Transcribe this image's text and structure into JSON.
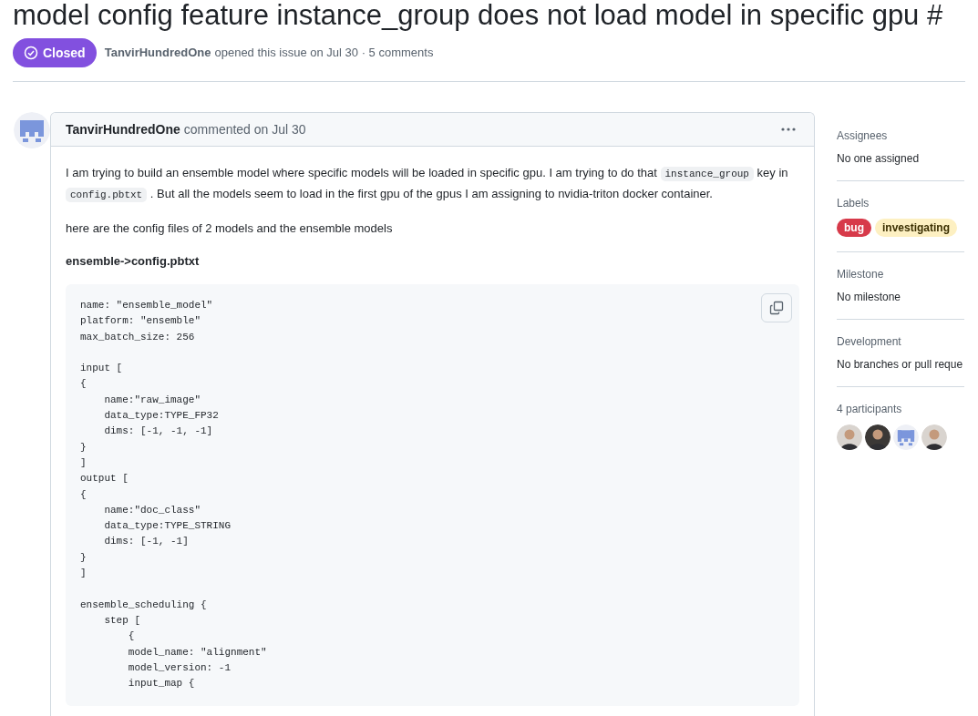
{
  "issue": {
    "title": "model config feature instance_group does not load model in specific gpu #",
    "status": "Closed",
    "author": "TanvirHundredOne",
    "meta": "opened this issue on Jul 30 · 5 comments"
  },
  "comment": {
    "author": "TanvirHundredOne",
    "meta": "commented on Jul 30",
    "body": [
      {
        "kind": "paragraph",
        "segments": [
          {
            "kind": "text",
            "text": "I am trying to build an ensemble model where specific models will be loaded in specific gpu. I am trying to do that "
          },
          {
            "kind": "code",
            "text": "instance_group"
          },
          {
            "kind": "text",
            "text": " key in "
          },
          {
            "kind": "code",
            "text": "config.pbtxt"
          },
          {
            "kind": "text",
            "text": " . But all the models seem to load in the first gpu of the gpus I am assigning to nvidia-triton docker container."
          }
        ]
      },
      {
        "kind": "paragraph",
        "segments": [
          {
            "kind": "text",
            "text": "here are the config files of 2 models and the ensemble models"
          }
        ]
      },
      {
        "kind": "heading",
        "text": "ensemble->config.pbtxt"
      },
      {
        "kind": "code",
        "text": "name: \"ensemble_model\"\nplatform: \"ensemble\"\nmax_batch_size: 256\n\ninput [\n{\n    name:\"raw_image\"\n    data_type:TYPE_FP32\n    dims: [-1, -1, -1]\n}\n]\noutput [\n{\n    name:\"doc_class\"\n    data_type:TYPE_STRING\n    dims: [-1, -1]\n}\n]\n\nensemble_scheduling {\n    step [\n        {\n        model_name: \"alignment\"\n        model_version: -1\n        input_map {"
      }
    ]
  },
  "sidebar": [
    {
      "heading": "Assignees",
      "value": "No one assigned"
    },
    {
      "heading": "Labels",
      "labels": [
        {
          "text": "bug",
          "color": "#d73a4a"
        },
        {
          "text": "investigating",
          "color": "#fdf0c2"
        }
      ]
    },
    {
      "heading": "Milestone",
      "value": "No milestone"
    },
    {
      "heading": "Development",
      "value": "No branches or pull reque"
    },
    {
      "heading": "4 participants",
      "participants": [
        {
          "kind": "photo"
        },
        {
          "kind": "photo"
        },
        {
          "kind": "identicon"
        },
        {
          "kind": "photo"
        }
      ]
    }
  ]
}
